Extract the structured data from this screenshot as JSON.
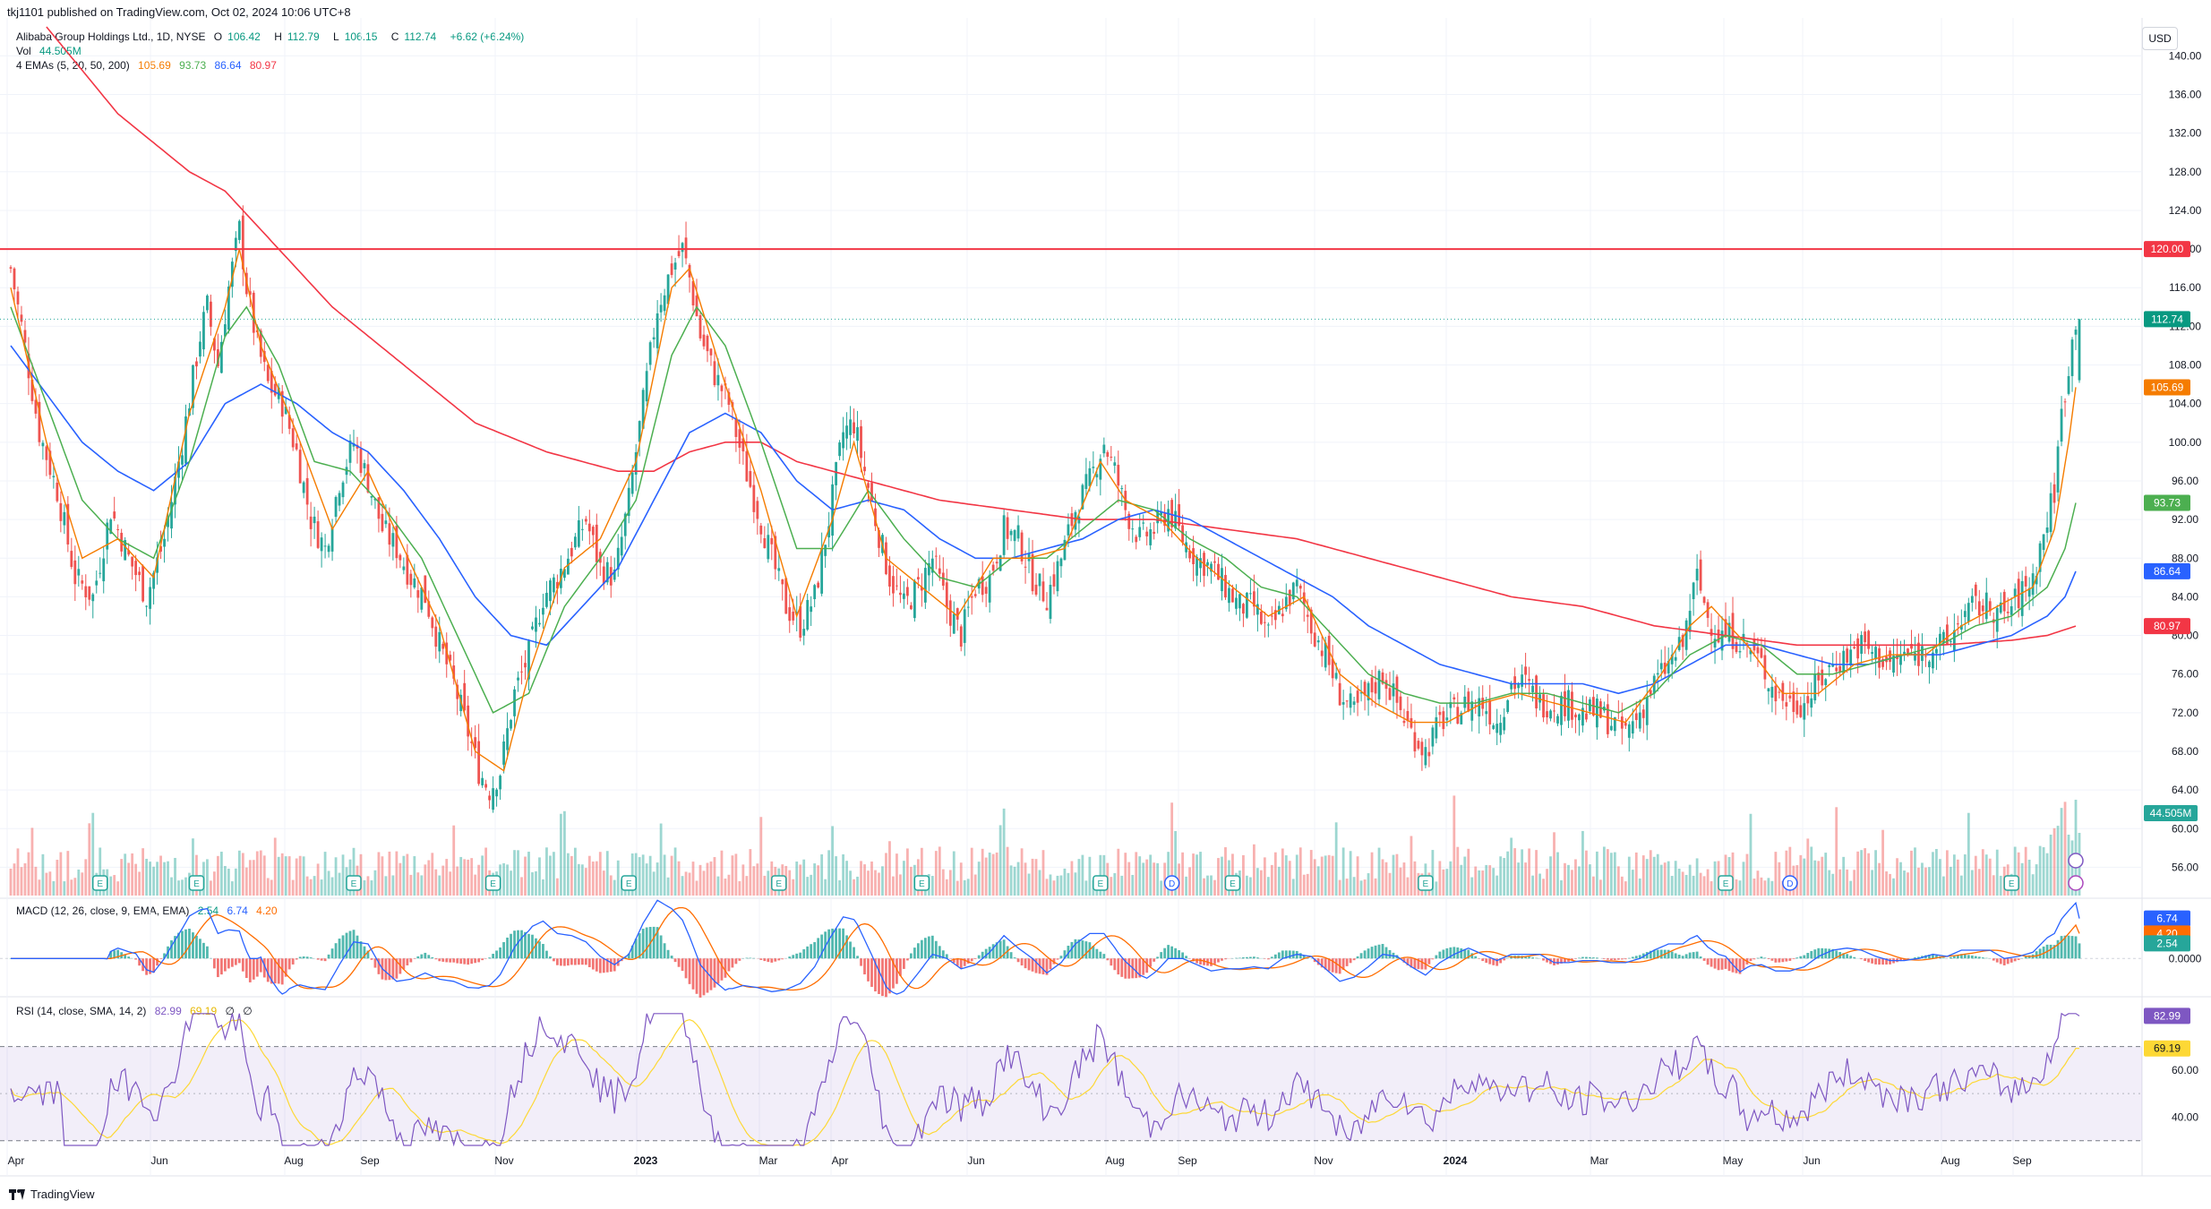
{
  "header": {
    "published": "tkj1101 published on TradingView.com, Oct 02, 2024 10:06 UTC+8"
  },
  "legend": {
    "symbol": "Alibaba Group Holdings Ltd., 1D, NYSE",
    "o_label": "O",
    "o_value": "106.42",
    "h_label": "H",
    "h_value": "112.79",
    "l_label": "L",
    "l_value": "106.15",
    "c_label": "C",
    "c_value": "112.74",
    "change": "+6.62 (+6.24%)",
    "vol_label": "Vol",
    "vol_value": "44.505M",
    "ema_label": "4 EMAs (5, 20, 50, 200)",
    "ema5": "105.69",
    "ema20": "93.73",
    "ema50": "86.64",
    "ema200": "80.97",
    "macd_label": "MACD (12, 26, close, 9, EMA, EMA)",
    "macd_hist": "2.54",
    "macd_line": "6.74",
    "macd_signal": "4.20",
    "rsi_label": "RSI (14, close, SMA, 14, 2)",
    "rsi_value": "82.99",
    "rsi_ma": "69.19",
    "rsi_extra1": "∅",
    "rsi_extra2": "∅"
  },
  "currency_button": "USD",
  "footer": {
    "brand": "TradingView"
  },
  "colors": {
    "up": "#26a69a",
    "down": "#ef5350",
    "ema5": "#f57c00",
    "ema20": "#4caf50",
    "ema50": "#2962ff",
    "ema200": "#f23645",
    "resistance": "#f23645",
    "rsi": "#7e57c2",
    "rsi_ma": "#fdd835",
    "macd_line": "#2962ff",
    "macd_signal": "#ff6d00"
  },
  "chart_data": {
    "type": "candlestick",
    "ylim": [
      54,
      143
    ],
    "y_ticks": [
      "140.00",
      "136.00",
      "132.00",
      "128.00",
      "124.00",
      "120.00",
      "116.00",
      "112.00",
      "108.00",
      "104.00",
      "100.00",
      "96.00",
      "92.00",
      "88.00",
      "84.00",
      "80.00",
      "76.00",
      "72.00",
      "68.00",
      "64.00",
      "60.00",
      "56.00"
    ],
    "x_ticks": [
      "Apr",
      "Jun",
      "Aug",
      "Sep",
      "Nov",
      "2023",
      "Mar",
      "Apr",
      "Jun",
      "Aug",
      "Sep",
      "Nov",
      "2024",
      "Mar",
      "May",
      "Jun",
      "Aug",
      "Sep"
    ],
    "resistance": {
      "value": 120.0,
      "label": "120.00"
    },
    "last_price": {
      "value": 112.74,
      "label": "112.74"
    },
    "ema_end_labels": [
      {
        "name": "EMA 5",
        "value": 105.69,
        "label": "105.69"
      },
      {
        "name": "EMA 20",
        "value": 93.73,
        "label": "93.73"
      },
      {
        "name": "EMA 50",
        "value": 86.64,
        "label": "86.64"
      },
      {
        "name": "EMA 200",
        "value": 80.97,
        "label": "80.97"
      }
    ],
    "volume_label": "44.505M",
    "close_anchors": [
      [
        0,
        118
      ],
      [
        3,
        112
      ],
      [
        8,
        101
      ],
      [
        13,
        95
      ],
      [
        18,
        86
      ],
      [
        23,
        84
      ],
      [
        28,
        93
      ],
      [
        33,
        88
      ],
      [
        38,
        84
      ],
      [
        43,
        90
      ],
      [
        48,
        100
      ],
      [
        53,
        111
      ],
      [
        55,
        114
      ],
      [
        58,
        108
      ],
      [
        61,
        116
      ],
      [
        64,
        122
      ],
      [
        66,
        116
      ],
      [
        69,
        110
      ],
      [
        72,
        106
      ],
      [
        76,
        104
      ],
      [
        80,
        99
      ],
      [
        84,
        92
      ],
      [
        88,
        89
      ],
      [
        92,
        96
      ],
      [
        96,
        100
      ],
      [
        100,
        96
      ],
      [
        104,
        91
      ],
      [
        108,
        89
      ],
      [
        112,
        86
      ],
      [
        116,
        84
      ],
      [
        120,
        79
      ],
      [
        124,
        75
      ],
      [
        128,
        70
      ],
      [
        131,
        66
      ],
      [
        134,
        64
      ],
      [
        137,
        66
      ],
      [
        141,
        74
      ],
      [
        145,
        78
      ],
      [
        149,
        84
      ],
      [
        153,
        86
      ],
      [
        157,
        89
      ],
      [
        161,
        92
      ],
      [
        165,
        87
      ],
      [
        169,
        86
      ],
      [
        173,
        94
      ],
      [
        177,
        104
      ],
      [
        181,
        114
      ],
      [
        185,
        118
      ],
      [
        188,
        120
      ],
      [
        190,
        117
      ],
      [
        193,
        111
      ],
      [
        197,
        107
      ],
      [
        201,
        104
      ],
      [
        205,
        98
      ],
      [
        209,
        93
      ],
      [
        213,
        88
      ],
      [
        217,
        83
      ],
      [
        221,
        81
      ],
      [
        225,
        84
      ],
      [
        229,
        92
      ],
      [
        233,
        101
      ],
      [
        236,
        102
      ],
      [
        239,
        97
      ],
      [
        242,
        92
      ],
      [
        246,
        86
      ],
      [
        250,
        83
      ],
      [
        254,
        85
      ],
      [
        258,
        88
      ],
      [
        262,
        83
      ],
      [
        266,
        80
      ],
      [
        270,
        85
      ],
      [
        274,
        86
      ],
      [
        278,
        91
      ],
      [
        282,
        90
      ],
      [
        286,
        86
      ],
      [
        290,
        84
      ],
      [
        294,
        88
      ],
      [
        298,
        93
      ],
      [
        302,
        96
      ],
      [
        306,
        100
      ],
      [
        309,
        97
      ],
      [
        312,
        93
      ],
      [
        316,
        90
      ],
      [
        320,
        91
      ],
      [
        324,
        93
      ],
      [
        328,
        90
      ],
      [
        332,
        88
      ],
      [
        336,
        87
      ],
      [
        340,
        85
      ],
      [
        344,
        83
      ],
      [
        348,
        83
      ],
      [
        352,
        80
      ],
      [
        356,
        83
      ],
      [
        360,
        85
      ],
      [
        364,
        81
      ],
      [
        368,
        78
      ],
      [
        372,
        74
      ],
      [
        376,
        72
      ],
      [
        380,
        74
      ],
      [
        384,
        76
      ],
      [
        388,
        73
      ],
      [
        392,
        70
      ],
      [
        396,
        68
      ],
      [
        400,
        71
      ],
      [
        404,
        72
      ],
      [
        408,
        73
      ],
      [
        412,
        73
      ],
      [
        416,
        71
      ],
      [
        420,
        75
      ],
      [
        424,
        75
      ],
      [
        428,
        73
      ],
      [
        432,
        73
      ],
      [
        436,
        73
      ],
      [
        440,
        72
      ],
      [
        444,
        72
      ],
      [
        448,
        71
      ],
      [
        452,
        70
      ],
      [
        456,
        72
      ],
      [
        460,
        75
      ],
      [
        464,
        77
      ],
      [
        468,
        79
      ],
      [
        470,
        83
      ],
      [
        472,
        86
      ],
      [
        475,
        82
      ],
      [
        478,
        80
      ],
      [
        482,
        80
      ],
      [
        486,
        79
      ],
      [
        490,
        77
      ],
      [
        494,
        74
      ],
      [
        498,
        73
      ],
      [
        502,
        73
      ],
      [
        506,
        75
      ],
      [
        510,
        77
      ],
      [
        514,
        78
      ],
      [
        518,
        79
      ],
      [
        522,
        78
      ],
      [
        526,
        77
      ],
      [
        530,
        78
      ],
      [
        534,
        78
      ],
      [
        538,
        79
      ],
      [
        542,
        79
      ],
      [
        546,
        82
      ],
      [
        550,
        83
      ],
      [
        554,
        83
      ],
      [
        558,
        82
      ],
      [
        562,
        84
      ],
      [
        566,
        86
      ],
      [
        570,
        92
      ],
      [
        572,
        95
      ],
      [
        574,
        103
      ],
      [
        576,
        108
      ],
      [
        578,
        112.74
      ]
    ],
    "ema5_anchors": [
      [
        0,
        116
      ],
      [
        10,
        100
      ],
      [
        20,
        88
      ],
      [
        30,
        90
      ],
      [
        40,
        86
      ],
      [
        50,
        103
      ],
      [
        60,
        114
      ],
      [
        64,
        120
      ],
      [
        70,
        110
      ],
      [
        80,
        101
      ],
      [
        90,
        91
      ],
      [
        100,
        97
      ],
      [
        110,
        89
      ],
      [
        120,
        81
      ],
      [
        130,
        68
      ],
      [
        138,
        66
      ],
      [
        145,
        76
      ],
      [
        155,
        87
      ],
      [
        165,
        90
      ],
      [
        175,
        98
      ],
      [
        185,
        116
      ],
      [
        190,
        118
      ],
      [
        200,
        106
      ],
      [
        210,
        95
      ],
      [
        220,
        82
      ],
      [
        230,
        92
      ],
      [
        236,
        100
      ],
      [
        245,
        88
      ],
      [
        255,
        85
      ],
      [
        265,
        82
      ],
      [
        275,
        88
      ],
      [
        285,
        88
      ],
      [
        295,
        89
      ],
      [
        305,
        98
      ],
      [
        312,
        94
      ],
      [
        322,
        92
      ],
      [
        332,
        88
      ],
      [
        342,
        85
      ],
      [
        352,
        82
      ],
      [
        362,
        84
      ],
      [
        372,
        76
      ],
      [
        382,
        73
      ],
      [
        392,
        71
      ],
      [
        402,
        71
      ],
      [
        412,
        73
      ],
      [
        422,
        74
      ],
      [
        432,
        73
      ],
      [
        442,
        72
      ],
      [
        452,
        71
      ],
      [
        462,
        76
      ],
      [
        470,
        81
      ],
      [
        476,
        83
      ],
      [
        486,
        79
      ],
      [
        496,
        74
      ],
      [
        506,
        74
      ],
      [
        516,
        77
      ],
      [
        526,
        78
      ],
      [
        536,
        78
      ],
      [
        546,
        81
      ],
      [
        556,
        83
      ],
      [
        566,
        85
      ],
      [
        572,
        91
      ],
      [
        576,
        100
      ],
      [
        578,
        105.69
      ]
    ],
    "ema20_anchors": [
      [
        0,
        114
      ],
      [
        10,
        104
      ],
      [
        20,
        94
      ],
      [
        30,
        90
      ],
      [
        40,
        88
      ],
      [
        50,
        98
      ],
      [
        60,
        111
      ],
      [
        66,
        114
      ],
      [
        75,
        108
      ],
      [
        85,
        98
      ],
      [
        95,
        97
      ],
      [
        105,
        93
      ],
      [
        115,
        88
      ],
      [
        125,
        80
      ],
      [
        135,
        72
      ],
      [
        145,
        74
      ],
      [
        155,
        83
      ],
      [
        165,
        88
      ],
      [
        175,
        94
      ],
      [
        185,
        109
      ],
      [
        192,
        114
      ],
      [
        200,
        110
      ],
      [
        210,
        100
      ],
      [
        220,
        89
      ],
      [
        230,
        89
      ],
      [
        240,
        95
      ],
      [
        250,
        90
      ],
      [
        260,
        86
      ],
      [
        270,
        85
      ],
      [
        280,
        88
      ],
      [
        290,
        88
      ],
      [
        300,
        91
      ],
      [
        310,
        94
      ],
      [
        320,
        93
      ],
      [
        330,
        90
      ],
      [
        340,
        88
      ],
      [
        350,
        85
      ],
      [
        360,
        84
      ],
      [
        370,
        80
      ],
      [
        380,
        76
      ],
      [
        390,
        74
      ],
      [
        400,
        73
      ],
      [
        410,
        73
      ],
      [
        420,
        74
      ],
      [
        430,
        74
      ],
      [
        440,
        73
      ],
      [
        450,
        72
      ],
      [
        460,
        74
      ],
      [
        470,
        78
      ],
      [
        480,
        80
      ],
      [
        490,
        79
      ],
      [
        500,
        76
      ],
      [
        510,
        76
      ],
      [
        520,
        77
      ],
      [
        530,
        78
      ],
      [
        540,
        79
      ],
      [
        550,
        81
      ],
      [
        560,
        82
      ],
      [
        570,
        85
      ],
      [
        575,
        89
      ],
      [
        578,
        93.73
      ]
    ],
    "ema50_anchors": [
      [
        0,
        110
      ],
      [
        10,
        105
      ],
      [
        20,
        100
      ],
      [
        30,
        97
      ],
      [
        40,
        95
      ],
      [
        50,
        98
      ],
      [
        60,
        104
      ],
      [
        70,
        106
      ],
      [
        80,
        104
      ],
      [
        90,
        101
      ],
      [
        100,
        99
      ],
      [
        110,
        95
      ],
      [
        120,
        90
      ],
      [
        130,
        84
      ],
      [
        140,
        80
      ],
      [
        150,
        79
      ],
      [
        160,
        83
      ],
      [
        170,
        87
      ],
      [
        180,
        94
      ],
      [
        190,
        101
      ],
      [
        200,
        103
      ],
      [
        210,
        101
      ],
      [
        220,
        96
      ],
      [
        230,
        93
      ],
      [
        240,
        94
      ],
      [
        250,
        93
      ],
      [
        260,
        90
      ],
      [
        270,
        88
      ],
      [
        280,
        88
      ],
      [
        290,
        89
      ],
      [
        300,
        90
      ],
      [
        310,
        92
      ],
      [
        320,
        93
      ],
      [
        330,
        92
      ],
      [
        340,
        90
      ],
      [
        350,
        88
      ],
      [
        360,
        86
      ],
      [
        370,
        84
      ],
      [
        380,
        81
      ],
      [
        390,
        79
      ],
      [
        400,
        77
      ],
      [
        410,
        76
      ],
      [
        420,
        75
      ],
      [
        430,
        75
      ],
      [
        440,
        75
      ],
      [
        450,
        74
      ],
      [
        460,
        75
      ],
      [
        470,
        77
      ],
      [
        480,
        79
      ],
      [
        490,
        79
      ],
      [
        500,
        78
      ],
      [
        510,
        77
      ],
      [
        520,
        77
      ],
      [
        530,
        78
      ],
      [
        540,
        78
      ],
      [
        550,
        79
      ],
      [
        560,
        80
      ],
      [
        570,
        82
      ],
      [
        575,
        84
      ],
      [
        578,
        86.64
      ]
    ],
    "ema200_anchors": [
      [
        10,
        143
      ],
      [
        30,
        134
      ],
      [
        50,
        128
      ],
      [
        60,
        126
      ],
      [
        70,
        122
      ],
      [
        90,
        114
      ],
      [
        110,
        108
      ],
      [
        130,
        102
      ],
      [
        150,
        99
      ],
      [
        170,
        97
      ],
      [
        180,
        97
      ],
      [
        190,
        99
      ],
      [
        200,
        100
      ],
      [
        210,
        100
      ],
      [
        220,
        98
      ],
      [
        240,
        96
      ],
      [
        260,
        94
      ],
      [
        280,
        93
      ],
      [
        300,
        92
      ],
      [
        320,
        92
      ],
      [
        340,
        91
      ],
      [
        360,
        90
      ],
      [
        380,
        88
      ],
      [
        400,
        86
      ],
      [
        420,
        84
      ],
      [
        440,
        83
      ],
      [
        460,
        81
      ],
      [
        480,
        80
      ],
      [
        500,
        79
      ],
      [
        520,
        79
      ],
      [
        540,
        79
      ],
      [
        560,
        79.5
      ],
      [
        570,
        80
      ],
      [
        578,
        80.97
      ]
    ],
    "volume_max": 100,
    "macd": {
      "line_last": 6.74,
      "signal_last": 4.2,
      "hist_last": 2.54,
      "ylim": [
        -6,
        10
      ],
      "zero_label": "0.0000"
    },
    "rsi": {
      "value": 82.99,
      "ma": 69.19,
      "ylim": [
        20,
        90
      ],
      "ticks": [
        "60.00",
        "40.00"
      ],
      "band": [
        30,
        70
      ]
    },
    "earnings_markers": [
      {
        "type": "E",
        "bar": 25
      },
      {
        "type": "E",
        "bar": 52
      },
      {
        "type": "E",
        "bar": 96
      },
      {
        "type": "E",
        "bar": 135
      },
      {
        "type": "E",
        "bar": 173
      },
      {
        "type": "E",
        "bar": 215
      },
      {
        "type": "E",
        "bar": 255
      },
      {
        "type": "E",
        "bar": 305
      },
      {
        "type": "D",
        "bar": 325
      },
      {
        "type": "E",
        "bar": 342
      },
      {
        "type": "E",
        "bar": 396
      },
      {
        "type": "E",
        "bar": 480
      },
      {
        "type": "D",
        "bar": 498
      },
      {
        "type": "E",
        "bar": 560
      }
    ]
  }
}
